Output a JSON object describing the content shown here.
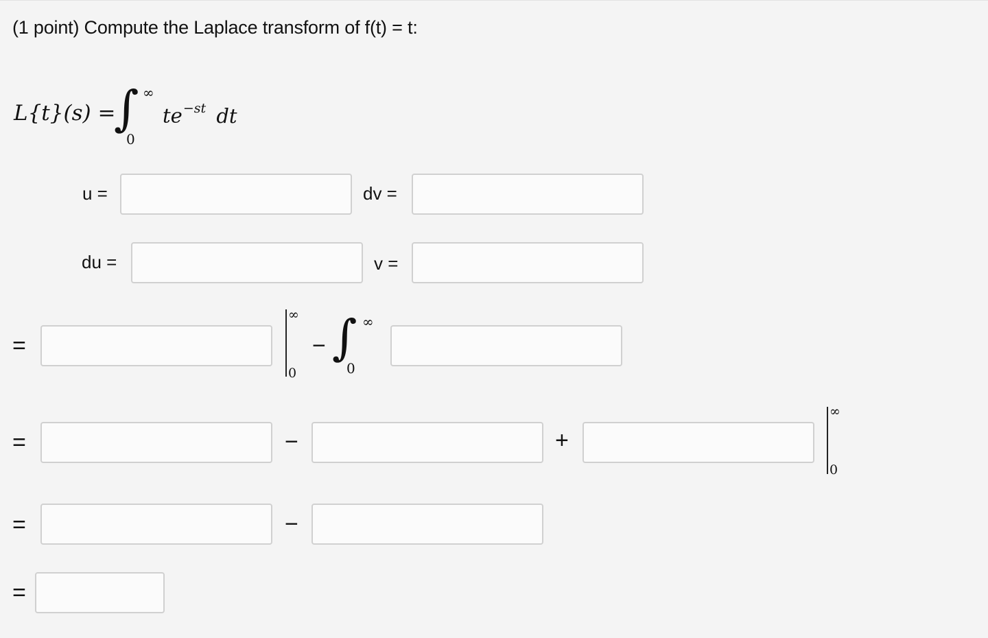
{
  "question": {
    "title": "(1 point) Compute the Laplace transform of f(t) = t:"
  },
  "formula": {
    "lhs_main": "L{t}(s) =",
    "integral_sign": "∫",
    "upper_limit": "∞",
    "lower_limit": "0",
    "integrand_base": "te",
    "integrand_exponent": "−st",
    "differential": "dt"
  },
  "parts": {
    "u_label": "u =",
    "dv_label": "dv =",
    "du_label": "du =",
    "v_label": "v ="
  },
  "steps": {
    "equals": "=",
    "minus": "−",
    "plus": "+",
    "eval_upper": "∞",
    "eval_lower": "0",
    "integral_sign": "∫",
    "integral_upper": "∞",
    "integral_lower": "0"
  },
  "inputs": {
    "u": "",
    "dv": "",
    "du": "",
    "v": "",
    "step1_uv": "",
    "step1_integrand": "",
    "step2_a": "",
    "step2_b": "",
    "step2_c": "",
    "step3_a": "",
    "step3_b": "",
    "final": ""
  }
}
